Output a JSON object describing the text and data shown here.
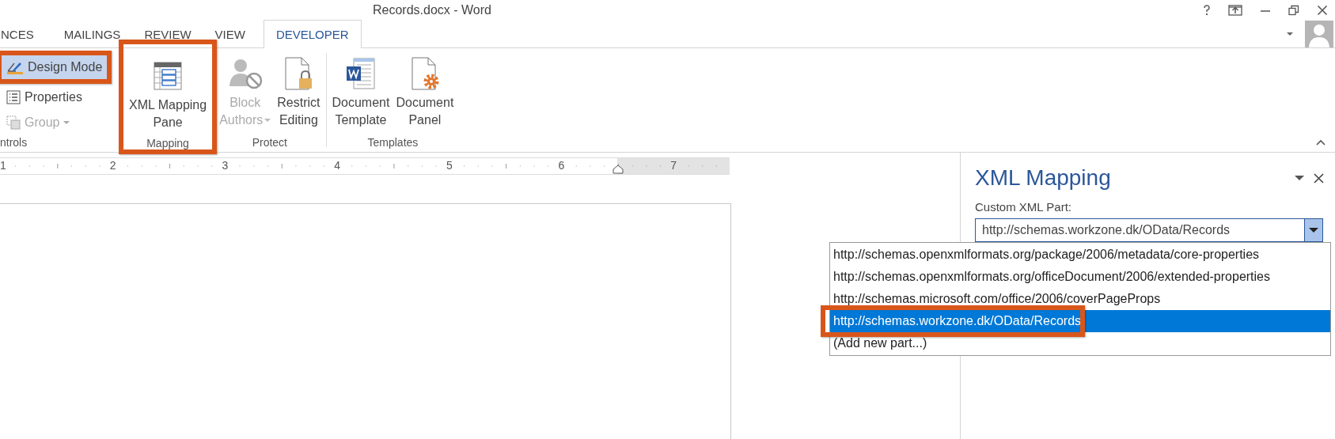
{
  "window": {
    "title": "Records.docx - Word"
  },
  "tabs": [
    {
      "label": "NCES",
      "selected": false
    },
    {
      "label": "MAILINGS",
      "selected": false
    },
    {
      "label": "REVIEW",
      "selected": false
    },
    {
      "label": "VIEW",
      "selected": false
    },
    {
      "label": "DEVELOPER",
      "selected": true
    }
  ],
  "ribbon": {
    "groups": [
      {
        "label": "ntrols",
        "kind": "small",
        "highlighted": false,
        "items": [
          {
            "lines": [
              "Design Mode"
            ],
            "selected": true,
            "disabled": false,
            "highlighted": true,
            "has_menu": false
          },
          {
            "lines": [
              "Properties"
            ],
            "selected": false,
            "disabled": false,
            "highlighted": false,
            "has_menu": false
          },
          {
            "lines": [
              "Group"
            ],
            "selected": false,
            "disabled": true,
            "highlighted": false,
            "has_menu": true
          }
        ]
      },
      {
        "label": "Mapping",
        "kind": "large",
        "highlighted": true,
        "items": [
          {
            "lines": [
              "XML Mapping",
              "Pane"
            ],
            "selected": false,
            "disabled": false,
            "highlighted": false,
            "has_menu": false
          }
        ]
      },
      {
        "label": "Protect",
        "kind": "large",
        "highlighted": false,
        "items": [
          {
            "lines": [
              "Block",
              "Authors"
            ],
            "selected": false,
            "disabled": true,
            "highlighted": false,
            "has_menu": true
          },
          {
            "lines": [
              "Restrict",
              "Editing"
            ],
            "selected": false,
            "disabled": false,
            "highlighted": false,
            "has_menu": false
          }
        ]
      },
      {
        "label": "Templates",
        "kind": "large",
        "highlighted": false,
        "items": [
          {
            "lines": [
              "Document",
              "Template"
            ],
            "selected": false,
            "disabled": false,
            "highlighted": false,
            "has_menu": false
          },
          {
            "lines": [
              "Document",
              "Panel"
            ],
            "selected": false,
            "disabled": false,
            "highlighted": false,
            "has_menu": false
          }
        ]
      }
    ]
  },
  "ruler": {
    "numbers": [
      "1",
      "2",
      "3",
      "4",
      "5",
      "6",
      "7"
    ]
  },
  "pane": {
    "title": "XML Mapping",
    "field_label": "Custom XML Part:",
    "value": "http://schemas.workzone.dk/OData/Records",
    "expanded": true,
    "options": [
      {
        "label": "http://schemas.openxmlformats.org/package/2006/metadata/core-properties",
        "selected": false,
        "highlighted": false
      },
      {
        "label": "http://schemas.openxmlformats.org/officeDocument/2006/extended-properties",
        "selected": false,
        "highlighted": false
      },
      {
        "label": "http://schemas.microsoft.com/office/2006/coverPageProps",
        "selected": false,
        "highlighted": false
      },
      {
        "label": "http://schemas.workzone.dk/OData/Records",
        "selected": true,
        "highlighted": true
      },
      {
        "label": "(Add new part...)",
        "selected": false,
        "highlighted": false
      }
    ]
  }
}
